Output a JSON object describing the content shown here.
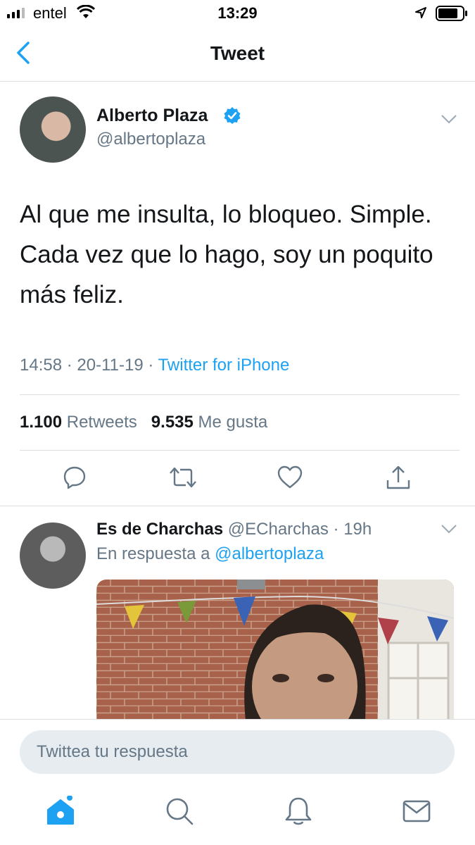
{
  "status_bar": {
    "carrier": "entel",
    "time": "13:29"
  },
  "nav": {
    "title": "Tweet"
  },
  "tweet": {
    "author_name": "Alberto Plaza",
    "author_handle": "@albertoplaza",
    "verified": true,
    "text": "Al que me insulta, lo bloqueo. Simple. Cada vez que lo hago, soy un poquito más feliz.",
    "time": "14:58",
    "date": "20-11-19",
    "source": "Twitter for iPhone",
    "retweet_count": "1.100",
    "retweet_label": "Retweets",
    "like_count": "9.535",
    "like_label": "Me gusta"
  },
  "reply": {
    "author_name": "Es de Charchas",
    "author_handle": "@ECharchas",
    "age": "19h",
    "replying_prefix": "En respuesta a",
    "replying_to": "@albertoplaza"
  },
  "composer": {
    "placeholder": "Twittea tu respuesta"
  },
  "colors": {
    "accent": "#1da1f2",
    "secondary_text": "#657786",
    "primary_text": "#14171a"
  },
  "icons": [
    "chevron-left-icon",
    "verified-badge-icon",
    "chevron-down-icon",
    "reply-icon",
    "retweet-icon",
    "like-icon",
    "share-icon",
    "home-icon",
    "search-icon",
    "notifications-icon",
    "messages-icon"
  ]
}
